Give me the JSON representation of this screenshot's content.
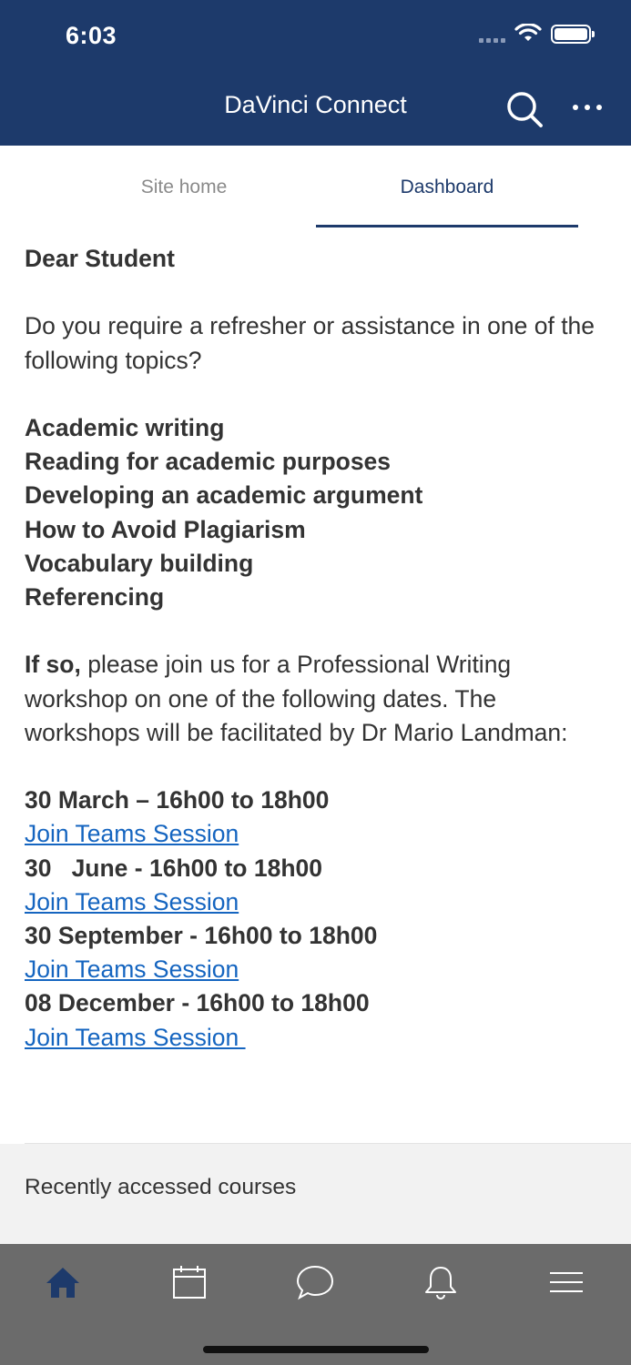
{
  "status_bar": {
    "time": "6:03"
  },
  "header": {
    "title": "DaVinci Connect"
  },
  "tabs": [
    {
      "label": "Site home",
      "active": false
    },
    {
      "label": "Dashboard",
      "active": true
    }
  ],
  "content": {
    "greeting": "Dear Student",
    "intro": "Do you require a refresher or assistance in one of the following topics?",
    "topics": [
      "Academic writing",
      "Reading for academic purposes",
      "Developing an academic argument",
      "How to Avoid Plagiarism",
      "Vocabulary building",
      "Referencing"
    ],
    "invite_bold": "If so,",
    "invite_rest": " please join us for a Professional Writing workshop on one of the following dates.  The workshops will be facilitated by Dr Mario Landman:",
    "sessions": [
      {
        "date": "30 March – 16h00 to 18h00",
        "link": "Join Teams Session"
      },
      {
        "date": "30   June - 16h00 to 18h00",
        "link": "Join Teams Session"
      },
      {
        "date": "30 September - 16h00 to 18h00",
        "link": "Join Teams Session"
      },
      {
        "date": "08 December - 16h00 to 18h00",
        "link": "Join Teams Session "
      }
    ]
  },
  "recent": {
    "label": "Recently accessed courses"
  },
  "tab_bar": {
    "items": [
      {
        "icon": "home-icon",
        "active": true
      },
      {
        "icon": "calendar-icon",
        "active": false
      },
      {
        "icon": "chat-icon",
        "active": false
      },
      {
        "icon": "bell-icon",
        "active": false
      },
      {
        "icon": "menu-icon",
        "active": false
      }
    ]
  },
  "colors": {
    "header_bg": "#1d3a6b",
    "link": "#1565c0",
    "tab_bar_bg": "#6b6b6b",
    "active_icon": "#1d3a6b"
  }
}
